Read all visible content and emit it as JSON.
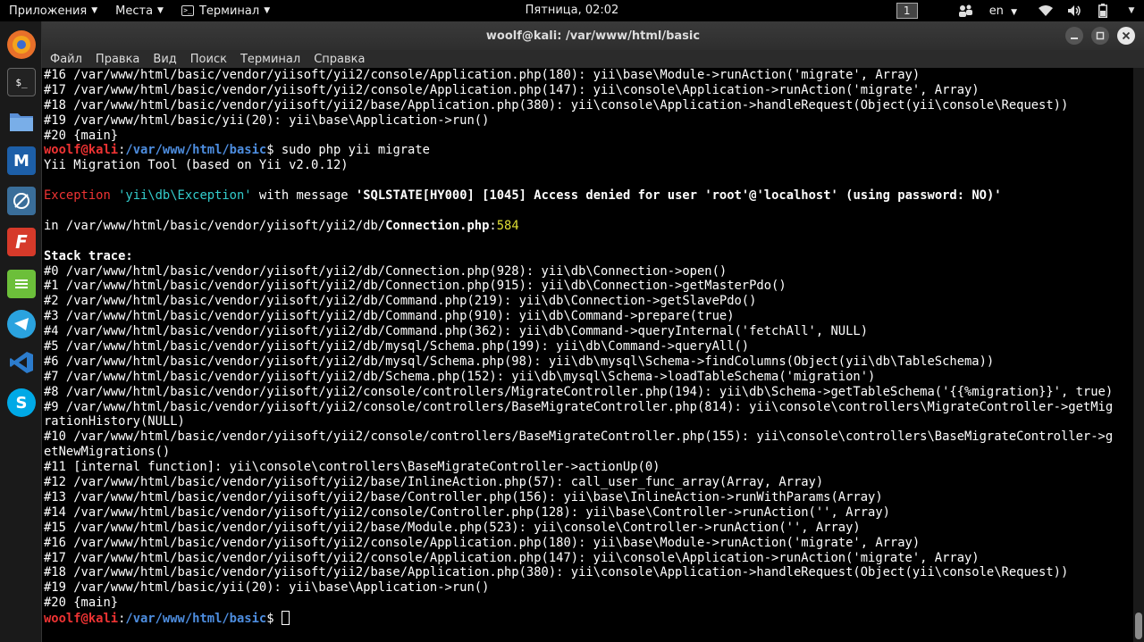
{
  "panel": {
    "apps_label": "Приложения",
    "places_label": "Места",
    "terminal_label": "Терминал",
    "clock": "Пятница, 02:02",
    "workspace": "1",
    "lang": "en"
  },
  "window": {
    "title": "woolf@kali: /var/www/html/basic",
    "menu": [
      "Файл",
      "Правка",
      "Вид",
      "Поиск",
      "Терминал",
      "Справка"
    ]
  },
  "terminal": {
    "top_lines": [
      "#16 /var/www/html/basic/vendor/yiisoft/yii2/console/Application.php(180): yii\\base\\Module->runAction('migrate', Array)",
      "#17 /var/www/html/basic/vendor/yiisoft/yii2/console/Application.php(147): yii\\console\\Application->runAction('migrate', Array)",
      "#18 /var/www/html/basic/vendor/yiisoft/yii2/base/Application.php(380): yii\\console\\Application->handleRequest(Object(yii\\console\\Request))",
      "#19 /var/www/html/basic/yii(20): yii\\base\\Application->run()",
      "#20 {main}"
    ],
    "prompt_user": "woolf@kali",
    "prompt_path": "/var/www/html/basic",
    "command": "sudo php yii migrate",
    "tool_line": "Yii Migration Tool (based on Yii v2.0.12)",
    "exception_word": "Exception",
    "exception_class": "'yii\\db\\Exception'",
    "exception_with": "with message",
    "exception_message": "'SQLSTATE[HY000] [1045] Access denied for user 'root'@'localhost' (using password: NO)'",
    "in_prefix": "in /var/www/html/basic/vendor/yiisoft/yii2/db/",
    "in_file": "Connection.php",
    "in_line": "584",
    "stack_title": "Stack trace:",
    "stack_lines": [
      "#0 /var/www/html/basic/vendor/yiisoft/yii2/db/Connection.php(928): yii\\db\\Connection->open()",
      "#1 /var/www/html/basic/vendor/yiisoft/yii2/db/Connection.php(915): yii\\db\\Connection->getMasterPdo()",
      "#2 /var/www/html/basic/vendor/yiisoft/yii2/db/Command.php(219): yii\\db\\Connection->getSlavePdo()",
      "#3 /var/www/html/basic/vendor/yiisoft/yii2/db/Command.php(910): yii\\db\\Command->prepare(true)",
      "#4 /var/www/html/basic/vendor/yiisoft/yii2/db/Command.php(362): yii\\db\\Command->queryInternal('fetchAll', NULL)",
      "#5 /var/www/html/basic/vendor/yiisoft/yii2/db/mysql/Schema.php(199): yii\\db\\Command->queryAll()",
      "#6 /var/www/html/basic/vendor/yiisoft/yii2/db/mysql/Schema.php(98): yii\\db\\mysql\\Schema->findColumns(Object(yii\\db\\TableSchema))",
      "#7 /var/www/html/basic/vendor/yiisoft/yii2/db/Schema.php(152): yii\\db\\mysql\\Schema->loadTableSchema('migration')",
      "#8 /var/www/html/basic/vendor/yiisoft/yii2/console/controllers/MigrateController.php(194): yii\\db\\Schema->getTableSchema('{{%migration}}', true)",
      "#9 /var/www/html/basic/vendor/yiisoft/yii2/console/controllers/BaseMigrateController.php(814): yii\\console\\controllers\\MigrateController->getMig",
      "rationHistory(NULL)",
      "#10 /var/www/html/basic/vendor/yiisoft/yii2/console/controllers/BaseMigrateController.php(155): yii\\console\\controllers\\BaseMigrateController->g",
      "etNewMigrations()",
      "#11 [internal function]: yii\\console\\controllers\\BaseMigrateController->actionUp(0)",
      "#12 /var/www/html/basic/vendor/yiisoft/yii2/base/InlineAction.php(57): call_user_func_array(Array, Array)",
      "#13 /var/www/html/basic/vendor/yiisoft/yii2/base/Controller.php(156): yii\\base\\InlineAction->runWithParams(Array)",
      "#14 /var/www/html/basic/vendor/yiisoft/yii2/console/Controller.php(128): yii\\base\\Controller->runAction('', Array)",
      "#15 /var/www/html/basic/vendor/yiisoft/yii2/base/Module.php(523): yii\\console\\Controller->runAction('', Array)",
      "#16 /var/www/html/basic/vendor/yiisoft/yii2/console/Application.php(180): yii\\base\\Module->runAction('migrate', Array)",
      "#17 /var/www/html/basic/vendor/yiisoft/yii2/console/Application.php(147): yii\\console\\Application->runAction('migrate', Array)",
      "#18 /var/www/html/basic/vendor/yiisoft/yii2/base/Application.php(380): yii\\console\\Application->handleRequest(Object(yii\\console\\Request))",
      "#19 /var/www/html/basic/yii(20): yii\\base\\Application->run()",
      "#20 {main}"
    ]
  },
  "colors": {
    "prompt_user": "#e33333",
    "prompt_path": "#4d8ddf",
    "exception": "#e33333",
    "exception_class": "#33cccc",
    "line_number": "#dddd33"
  }
}
